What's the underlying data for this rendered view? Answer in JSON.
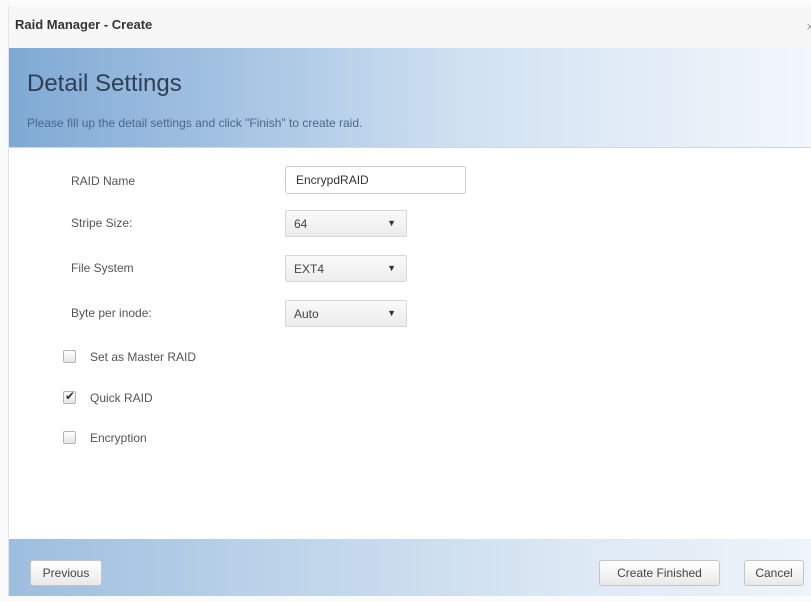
{
  "window": {
    "title": "Raid Manager - Create",
    "close_glyph": "×"
  },
  "banner": {
    "heading": "Detail Settings",
    "subheading": "Please fill up the detail settings and click \"Finish\" to create raid."
  },
  "form": {
    "raid_name": {
      "label": "RAID Name",
      "value": "EncrypdRAID"
    },
    "stripe_size": {
      "label": "Stripe Size:",
      "value": "64"
    },
    "file_system": {
      "label": "File System",
      "value": "EXT4"
    },
    "byte_per_inode": {
      "label": "Byte per inode:",
      "value": "Auto"
    },
    "dropdown_arrow": "▼"
  },
  "options": [
    {
      "label": "Set as Master RAID",
      "checked": false,
      "icon": "checkbox-icon"
    },
    {
      "label": "Quick RAID",
      "checked": true,
      "icon": "checkbox-checked-icon"
    },
    {
      "label": "Encryption",
      "checked": false,
      "icon": "checkbox-icon"
    }
  ],
  "check_glyph": "✔",
  "footer": {
    "previous_label": "Previous",
    "create_label": "Create Finished",
    "cancel_label": "Cancel"
  },
  "colors": {
    "banner_start": "#7fa9d4",
    "banner_end": "#f3f7fc",
    "heading": "#2f3f55"
  }
}
